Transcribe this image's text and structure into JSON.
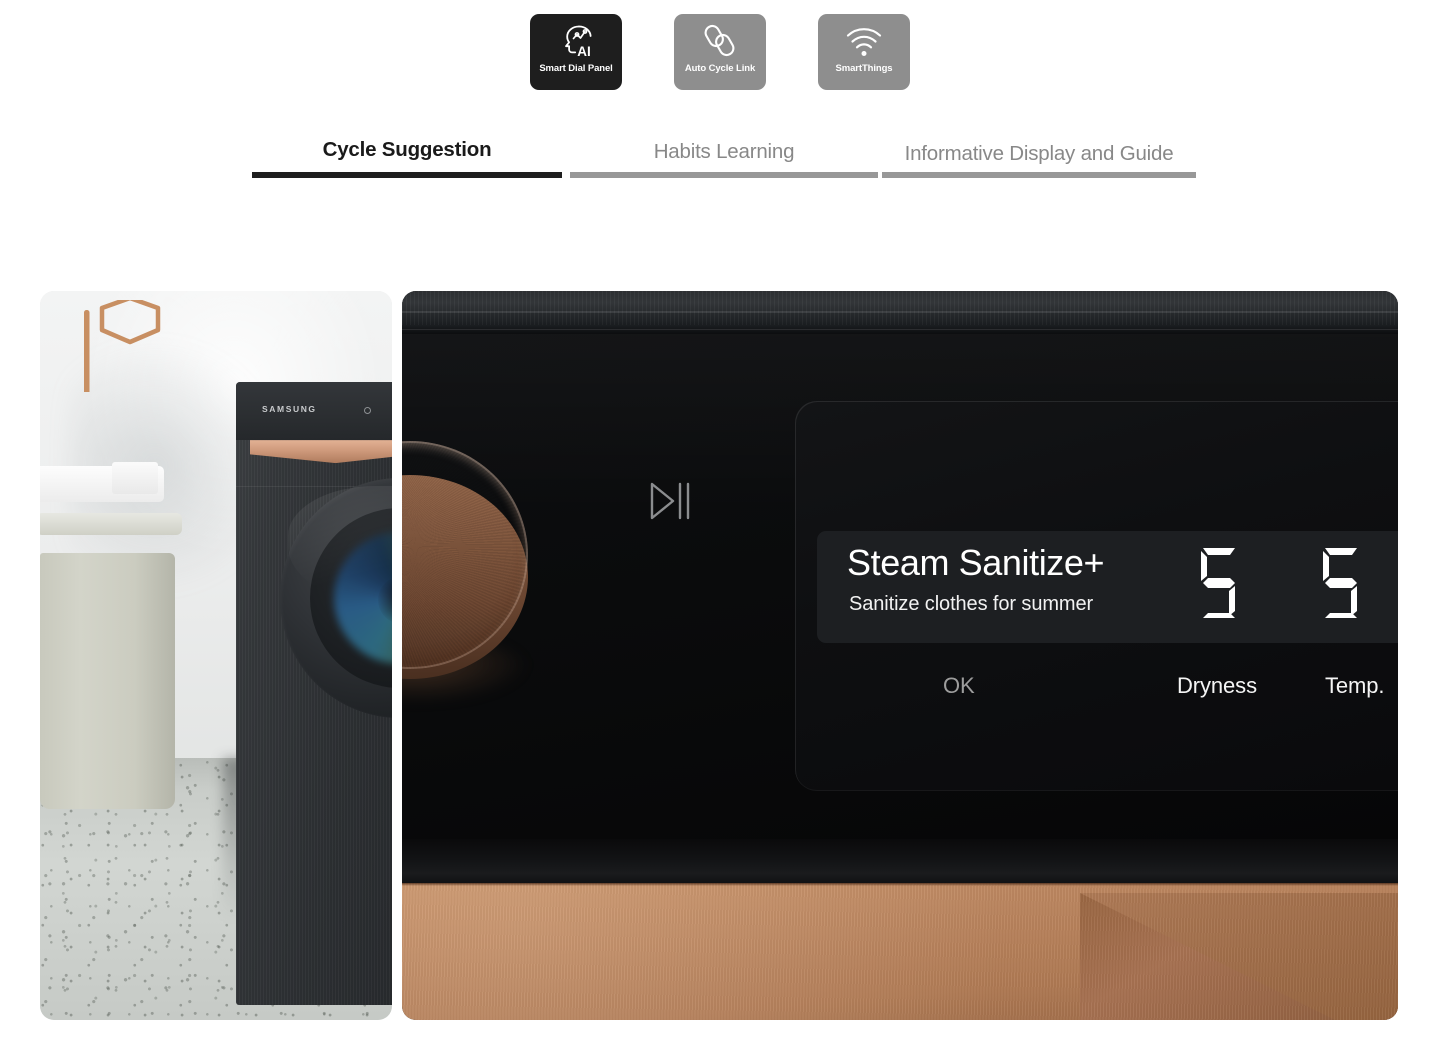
{
  "badges": [
    {
      "label": "Smart Dial Panel",
      "icon": "ai-head-icon",
      "style": "dark",
      "background": "#1e1e1e"
    },
    {
      "label": "Auto Cycle Link",
      "icon": "chain-link-icon",
      "style": "gray",
      "background": "#8e8e8e"
    },
    {
      "label": "SmartThings",
      "icon": "wifi-icon",
      "style": "gray",
      "background": "#8e8e8e"
    }
  ],
  "tabs": [
    {
      "label": "Cycle Suggestion",
      "active": true,
      "underline_color": "#1e1e1e"
    },
    {
      "label": "Habits Learning",
      "active": false,
      "underline_color": "#989898"
    },
    {
      "label": "Informative Display and Guide",
      "active": false,
      "underline_color": "#989898"
    }
  ],
  "left_photo": {
    "alt": "Samsung front-load washer in a laundry room with terrazzo floor",
    "brand_text": "SAMSUNG"
  },
  "right_photo": {
    "alt": "Close-up of washer Smart Dial control panel",
    "dial_icon": "rotary-dial",
    "play_pause_icon": "play-pause-icon",
    "display": {
      "cycle_name": "Steam Sanitize+",
      "cycle_description": "Sanitize clothes for summer",
      "digits": [
        "5",
        "5"
      ],
      "soft_keys": [
        {
          "label": "OK",
          "color": "#9d9d9d"
        },
        {
          "label": "Dryness",
          "color": "#f5f5f5"
        },
        {
          "label": "Temp.",
          "color": "#f5f5f5"
        }
      ]
    }
  },
  "colors": {
    "accent_copper": "#c69067",
    "panel_black": "#0a0a0b",
    "active_tab": "#1a1a1a",
    "inactive_tab": "#888888"
  }
}
